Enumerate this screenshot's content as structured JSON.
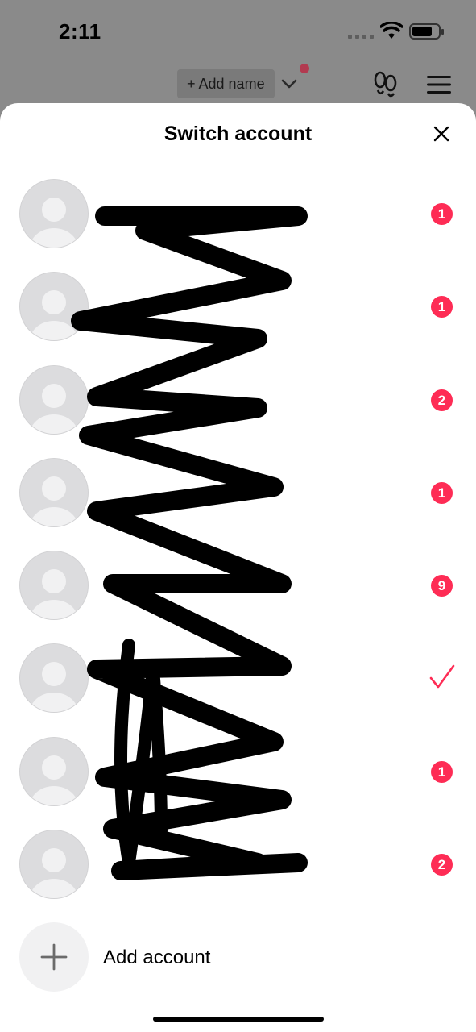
{
  "status_bar": {
    "time": "2:11"
  },
  "background": {
    "add_name_label": "+ Add name",
    "icons": [
      "chevron-down-icon",
      "footprints-icon",
      "menu-icon"
    ]
  },
  "sheet": {
    "title": "Switch account",
    "close_icon": "close-icon",
    "accounts": [
      {
        "name": "",
        "badge": "1",
        "selected": false
      },
      {
        "name": "",
        "badge": "1",
        "selected": false
      },
      {
        "name": "",
        "badge": "2",
        "selected": false
      },
      {
        "name": "",
        "badge": "1",
        "selected": false
      },
      {
        "name": "",
        "badge": "9",
        "selected": false
      },
      {
        "name": "",
        "badge": "",
        "selected": true
      },
      {
        "name": "",
        "badge": "1",
        "selected": false
      },
      {
        "name": "",
        "badge": "2",
        "selected": false
      }
    ],
    "add_account_label": "Add account"
  },
  "colors": {
    "accent": "#fe2c55",
    "overlay": "#8a8a8a",
    "avatar_bg": "#dcdcde"
  }
}
